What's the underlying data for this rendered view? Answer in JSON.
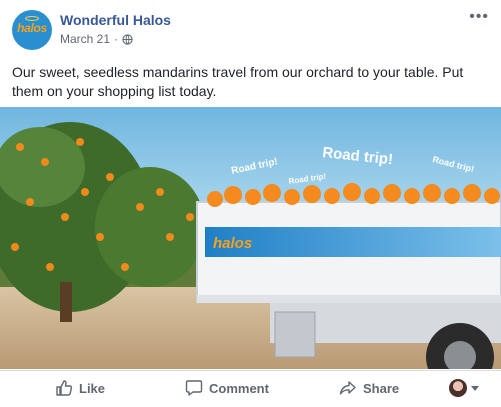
{
  "post": {
    "page_name": "Wonderful Halos",
    "avatar_logo_text": "halos",
    "date": "March 21",
    "separator": "·",
    "privacy_icon": "globe-icon",
    "more_icon": "more-horizontal-icon",
    "text": "Our sweet, seedless mandarins travel from our orchard to your table. Put them on your shopping list today."
  },
  "image": {
    "truck_logo": "halos",
    "bubbles": [
      "Road trip!",
      "Road trip!",
      "Road trip!",
      "Road trip!"
    ]
  },
  "actions": {
    "like_label": "Like",
    "comment_label": "Comment",
    "share_label": "Share",
    "like_icon": "thumbs-up-icon",
    "comment_icon": "comment-icon",
    "share_icon": "share-icon",
    "reactor_icon": "chevron-down-icon"
  },
  "colors": {
    "page_name": "#385898",
    "meta": "#616770",
    "action_text": "#606770",
    "sky": "#8fc9e8",
    "truck_stripe": "#2a90d4",
    "orange": "#f58a1f"
  }
}
